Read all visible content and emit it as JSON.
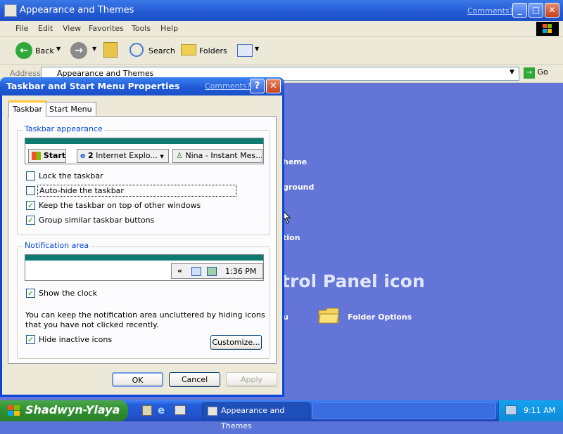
{
  "background_window": {
    "title": "Appearance and Themes",
    "comments": "Comments?",
    "menu": [
      "File",
      "Edit",
      "View",
      "Favorites",
      "Tools",
      "Help"
    ],
    "toolbar": {
      "back": "Back",
      "search": "Search",
      "folders": "Folders"
    },
    "address_label": "Address",
    "address_value": "Appearance and Themes",
    "go": "Go",
    "partial_links": [
      "heme",
      "ground",
      "tion"
    ],
    "heading": "trol Panel icon",
    "link_u": "u",
    "folder_options": "Folder Options"
  },
  "dialog": {
    "title": "Taskbar and Start Menu Properties",
    "comments": "Comments?",
    "help": "?",
    "close": "✕",
    "tabs": [
      "Taskbar",
      "Start Menu"
    ],
    "taskbar_appearance": {
      "label": "Taskbar appearance",
      "preview": {
        "start": "Start",
        "ie_count": "2",
        "ie": "Internet Explo...",
        "nina": "Nina - Instant Mes..."
      },
      "options": [
        {
          "label": "Lock the taskbar",
          "checked": false
        },
        {
          "label": "Auto-hide the taskbar",
          "checked": false
        },
        {
          "label": "Keep the taskbar on top of other windows",
          "checked": true
        },
        {
          "label": "Group similar taskbar buttons",
          "checked": true
        }
      ]
    },
    "notification_area": {
      "label": "Notification area",
      "preview_arrows": "«",
      "preview_time": "1:36 PM",
      "show_clock": {
        "label": "Show the clock",
        "checked": true
      },
      "description": "You can keep the notification area uncluttered by hiding icons that you have not clicked recently.",
      "hide_inactive": {
        "label": "Hide inactive icons",
        "checked": true
      },
      "customize": "Customize..."
    },
    "buttons": {
      "ok": "OK",
      "cancel": "Cancel",
      "apply": "Apply"
    }
  },
  "taskbar": {
    "start": "Shadwyn-Ylaya",
    "task": "Appearance and Themes",
    "time": "9:11 AM"
  }
}
